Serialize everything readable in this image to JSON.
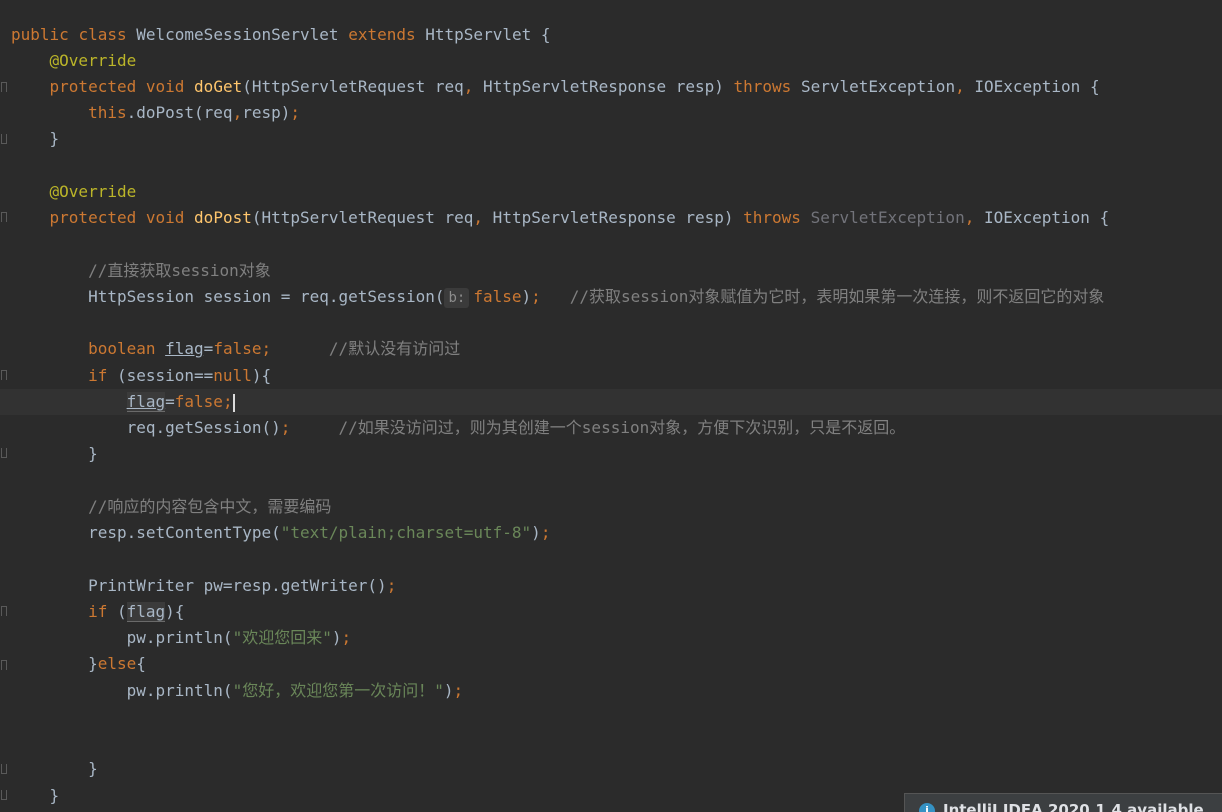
{
  "code": {
    "l1": {
      "kw1": "public",
      "kw2": "class",
      "name": "WelcomeSessionServlet",
      "kw3": "extends",
      "parent": "HttpServlet",
      "brace": "{"
    },
    "l2": "@Override",
    "l3": {
      "kw1": "protected",
      "kw2": "void",
      "fn": "doGet",
      "params": "(HttpServletRequest req",
      "comma1": ",",
      "params2": " HttpServletResponse resp) ",
      "throws": "throws",
      "ex1": " ServletException",
      "comma2": ",",
      "ex2": " IOException {"
    },
    "l4": {
      "kw": "this",
      "call": ".doPost(req",
      "comma": ",",
      "arg": "resp)",
      "semi": ";"
    },
    "l5": "}",
    "l7": "@Override",
    "l8": {
      "kw1": "protected",
      "kw2": "void",
      "fn": "doPost",
      "params": "(HttpServletRequest req",
      "comma1": ",",
      "params2": " HttpServletResponse resp) ",
      "throws": "throws",
      "ex1": " ServletException",
      "comma2": ",",
      "ex2": " IOException {"
    },
    "l10": "//直接获取session对象",
    "l11": {
      "code": "HttpSession session = req.getSession(",
      "hint": "b:",
      "val": "false",
      "close": ")",
      "semi": ";",
      "cmt": "//获取session对象赋值为它时，表明如果第一次连接，则不返回它的对象"
    },
    "l13": {
      "kw": "boolean",
      "var": "flag",
      "eq": "=",
      "val": "false",
      "semi": ";",
      "cmt": "//默认没有访问过"
    },
    "l14": {
      "kw": "if",
      "cond": " (session==",
      "nul": "null",
      "close": "){"
    },
    "l15": {
      "var": "flag",
      "eq": "=",
      "val": "false",
      "semi": ";"
    },
    "l16": {
      "code": "req.getSession()",
      "semi": ";",
      "cmt": "//如果没访问过，则为其创建一个session对象，方便下次识别，只是不返回。"
    },
    "l17": "}",
    "l19": "//响应的内容包含中文，需要编码",
    "l20": {
      "code": "resp.setContentType(",
      "str": "\"text/plain;charset=utf-8\"",
      "close": ")",
      "semi": ";"
    },
    "l22": {
      "code": "PrintWriter pw=resp.getWriter()",
      "semi": ";"
    },
    "l23": {
      "kw": "if",
      "open": " (",
      "var": "flag",
      "close": "){"
    },
    "l24": {
      "code": "pw.println(",
      "str": "\"欢迎您回来\"",
      "close": ")",
      "semi": ";"
    },
    "l25": {
      "brace": "}",
      "kw": "else",
      "open": "{"
    },
    "l26": {
      "code": "pw.println(",
      "str": "\"您好，欢迎您第一次访问！\"",
      "close": ")",
      "semi": ";"
    },
    "l29": "}",
    "l30": "}"
  },
  "notification": {
    "icon": "info-icon",
    "text": "IntelliJ IDEA 2020.1.4 available"
  },
  "colors": {
    "background": "#2b2b2b",
    "keyword": "#cc7832",
    "annotation": "#bbb529",
    "function": "#ffc66d",
    "string": "#6a8759",
    "comment": "#808080",
    "text": "#a9b7c6"
  }
}
